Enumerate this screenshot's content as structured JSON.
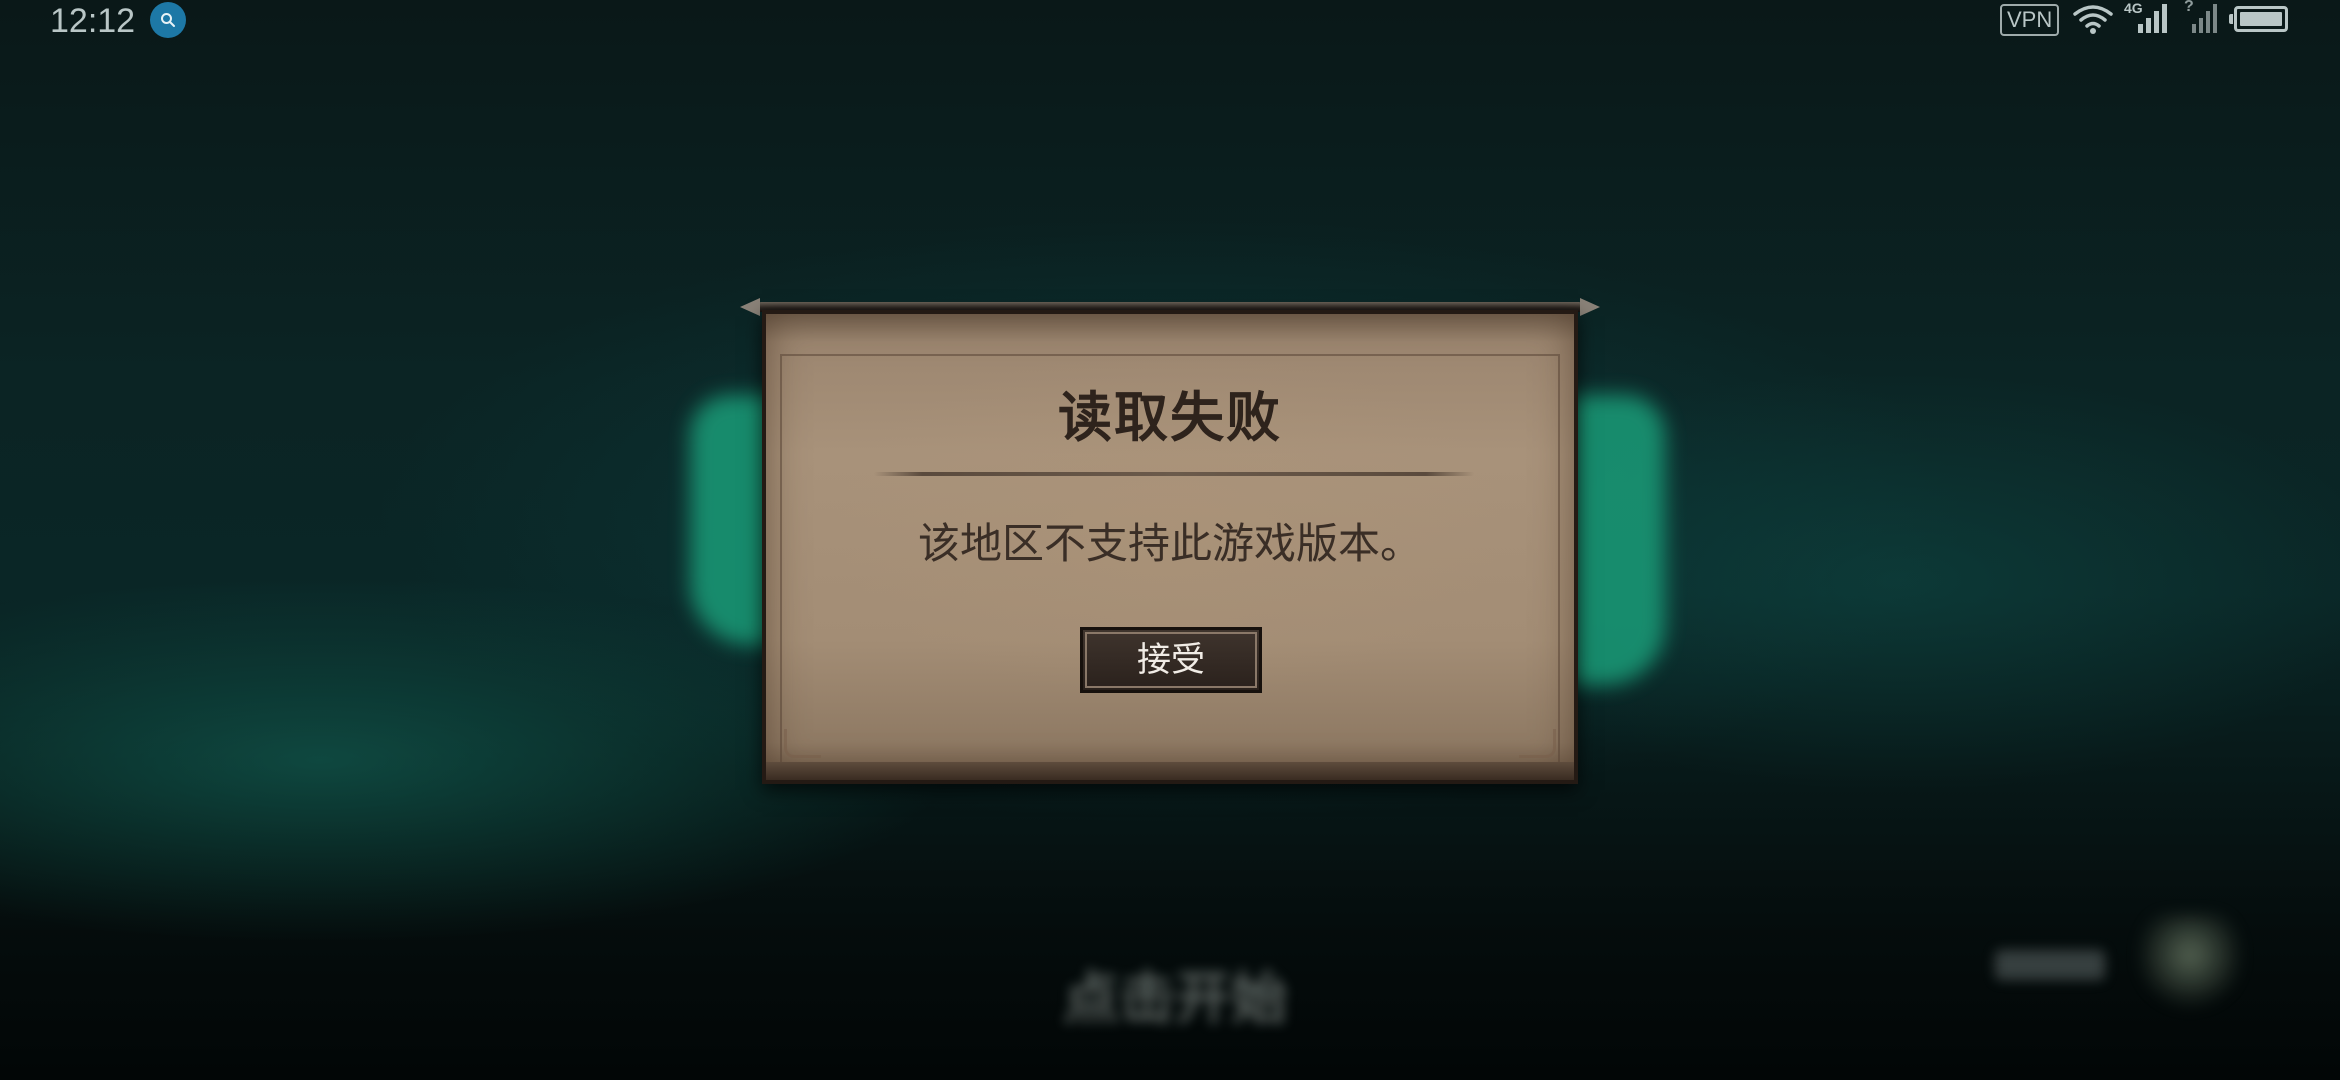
{
  "status_bar": {
    "time": "12:12",
    "notification_icon": "search-icon",
    "vpn_label": "VPN",
    "wifi_icon": "wifi-icon",
    "signal_primary_tag": "4G",
    "signal_secondary_tag": "?",
    "battery_icon": "battery-full-icon"
  },
  "background": {
    "start_prompt": "点击开始"
  },
  "dialog": {
    "title": "读取失败",
    "message": "该地区不支持此游戏版本。",
    "accept_label": "接受"
  },
  "colors": {
    "dialog_parchment": "#a8927a",
    "dialog_border": "#241a14",
    "button_bg": "#2a211c",
    "button_text": "#f1ece6",
    "title_text": "#2e231c",
    "background_teal": "#0b2424",
    "logo_green": "#1a9c78"
  }
}
